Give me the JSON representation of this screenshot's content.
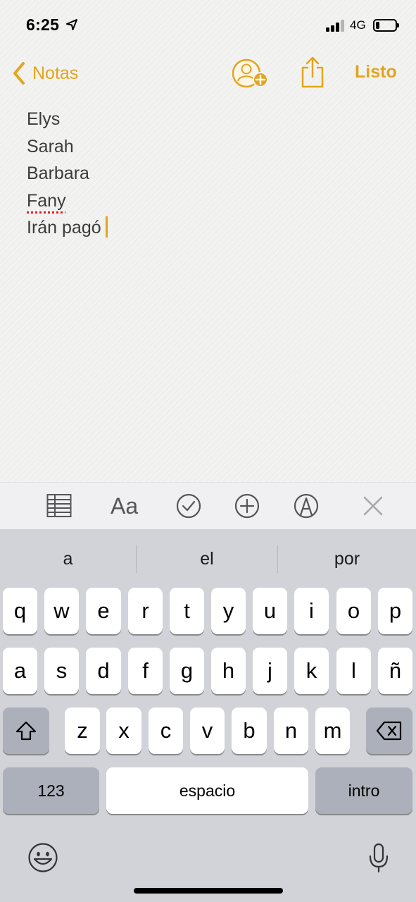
{
  "status_bar": {
    "time": "6:25",
    "network": "4G",
    "battery_level": 0.2
  },
  "nav": {
    "back_label": "Notas",
    "done_label": "Listo",
    "accent_color": "#e3a51c",
    "icons": [
      "chevron-left-icon",
      "add-person-icon",
      "share-icon"
    ]
  },
  "note": {
    "lines": [
      "Elys",
      "Sarah",
      "Barbara",
      "Fany",
      "Irán pagó"
    ],
    "misspelled_line": "Fany"
  },
  "format_toolbar": {
    "text_style_label": "Aa",
    "icons": [
      "table-icon",
      "text-style-icon",
      "checklist-icon",
      "add-icon",
      "markup-icon",
      "close-icon"
    ]
  },
  "keyboard": {
    "suggestions": [
      "a",
      "el",
      "por"
    ],
    "row1": [
      "q",
      "w",
      "e",
      "r",
      "t",
      "y",
      "u",
      "i",
      "o",
      "p"
    ],
    "row2": [
      "a",
      "s",
      "d",
      "f",
      "g",
      "h",
      "j",
      "k",
      "l",
      "ñ"
    ],
    "row3": [
      "z",
      "x",
      "c",
      "v",
      "b",
      "n",
      "m"
    ],
    "numbers_label": "123",
    "space_label": "espacio",
    "return_label": "intro",
    "icons": [
      "shift-icon",
      "backspace-icon",
      "emoji-icon",
      "microphone-icon"
    ]
  }
}
